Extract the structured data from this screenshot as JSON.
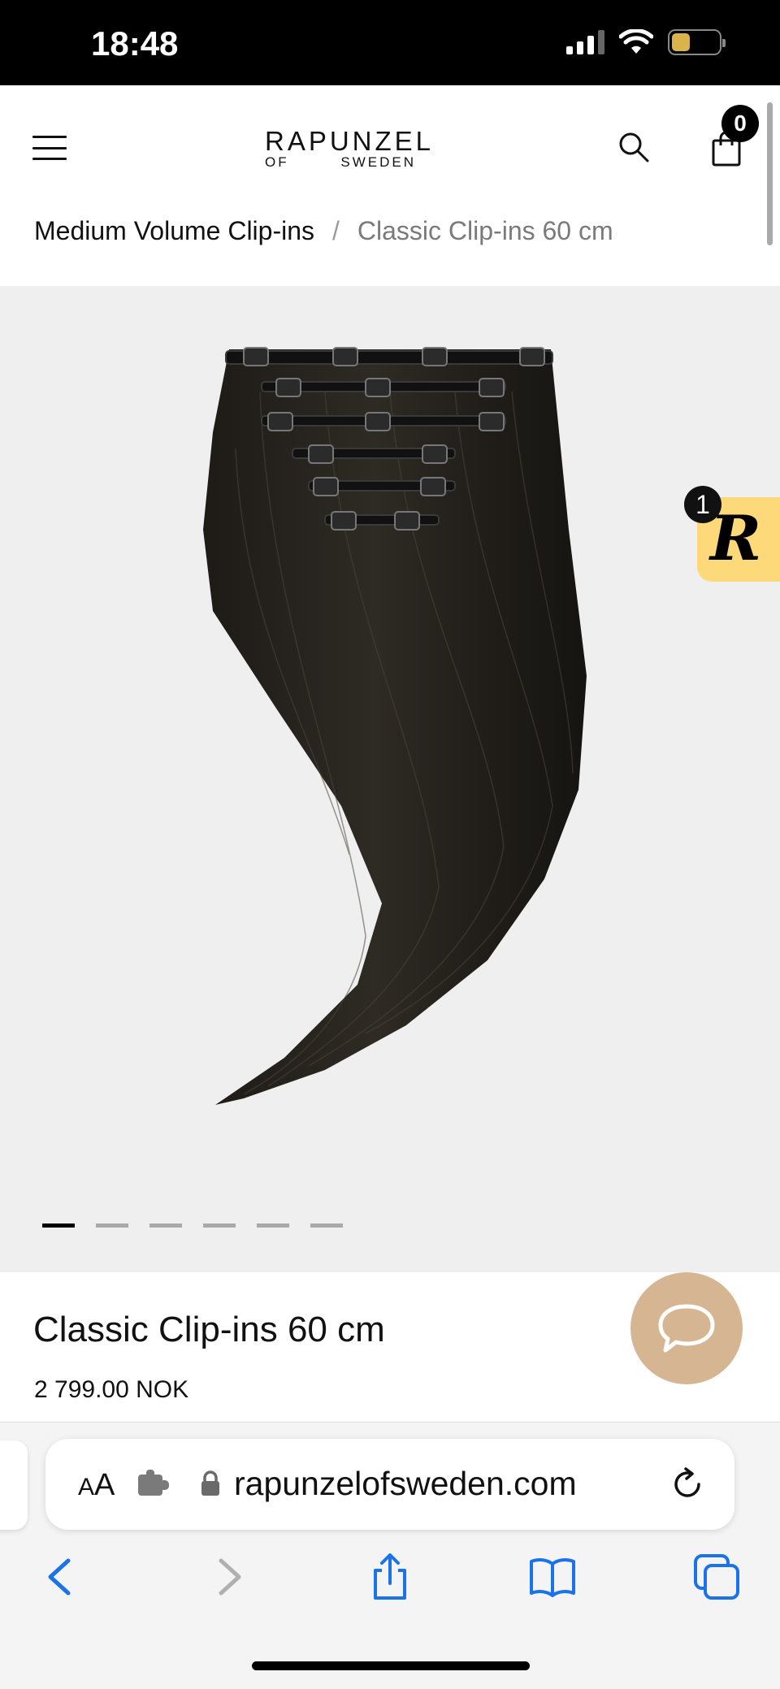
{
  "status_bar": {
    "time": "18:48",
    "battery": "5",
    "battery_color": "#d9b44a"
  },
  "header": {
    "logo_top": "RAPUNZEL",
    "logo_bottom_left": "OF",
    "logo_bottom_right": "SWEDEN",
    "cart_count": "0",
    "icons": [
      "menu-icon",
      "search-icon",
      "cart-icon"
    ]
  },
  "breadcrumb": {
    "parent": "Medium Volume Clip-ins",
    "separator": "/",
    "current": "Classic Clip-ins 60 cm"
  },
  "gallery": {
    "image_count": 6,
    "active_index": 0,
    "background": "#efefef"
  },
  "reward_widget": {
    "letter": "R",
    "badge": "1",
    "color": "#fdd97a"
  },
  "product": {
    "title": "Classic Clip-ins 60 cm",
    "price": "2 799.00 NOK"
  },
  "chat": {
    "icon": "chat-bubble-icon",
    "color": "#d6b592"
  },
  "browser": {
    "aa_label_small": "A",
    "aa_label_large": "A",
    "url": "rapunzelofsweden.com",
    "toolbar_icons": [
      "back-icon",
      "forward-icon",
      "share-icon",
      "bookmarks-icon",
      "tabs-icon"
    ],
    "accent": "#1a73e8"
  }
}
